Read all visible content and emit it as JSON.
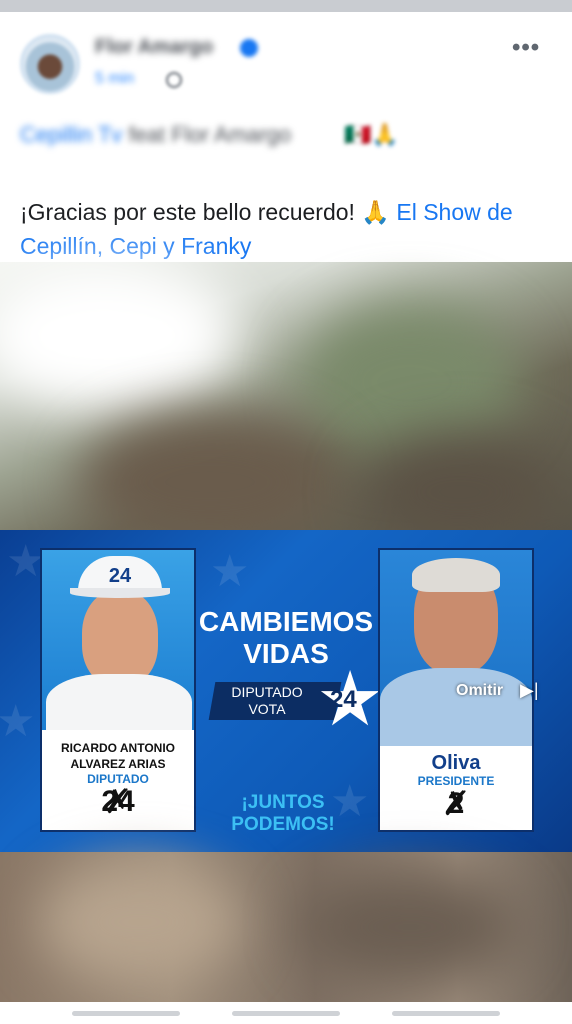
{
  "post": {
    "author": "Flor Amargo",
    "time": "5 min",
    "tagline_part1": "Cepillin Tv",
    "tagline_part2": "feat Flor Amargo",
    "tagline_emojis": "🇲🇽🙏",
    "text_main": "¡Gracias por este bello recuerdo! ",
    "text_emoji": "🙏",
    "text_link": "El Show de Cepillín, Cepi y Franky",
    "more_label": "•••"
  },
  "ad": {
    "headline_line1": "CAMBIEMOS",
    "headline_line2": "VIDAS",
    "vote_line1": "DIPUTADO",
    "vote_line2": "VOTA",
    "vote_number": "24",
    "juntos_line1": "¡JUNTOS",
    "juntos_line2": "PODEMOS!",
    "left_candidate": {
      "cap_number": "24",
      "name_line1": "RICARDO ANTONIO",
      "name_line2": "ALVAREZ ARIAS",
      "role": "DIPUTADO",
      "number": "24"
    },
    "right_candidate": {
      "name": "Oliva",
      "role": "PRESIDENTE",
      "number": "2"
    },
    "skip_label": "Omitir",
    "skip_icon": "▶|"
  },
  "colors": {
    "link": "#1877f2",
    "ad_blue": "#1466c6",
    "ad_navy": "#0c2d63",
    "ad_cyan": "#3cc0f4"
  }
}
